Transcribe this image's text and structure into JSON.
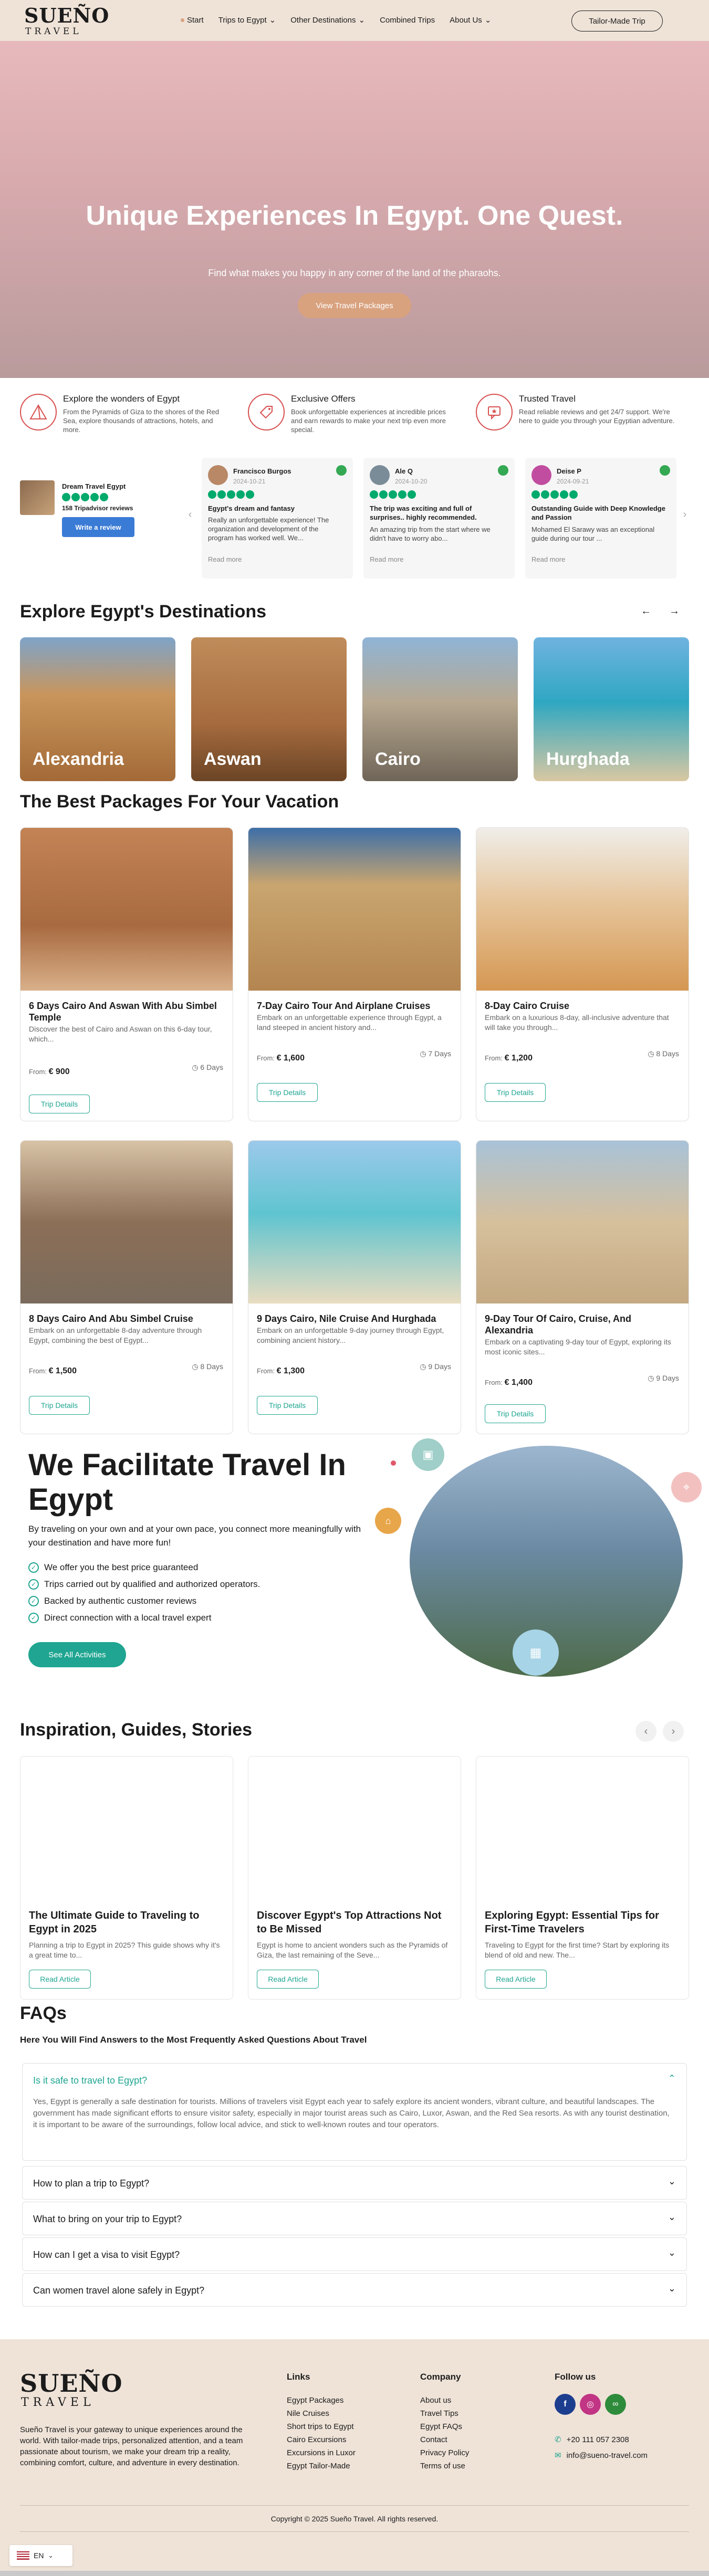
{
  "nav": {
    "logo_main": "SUEÑO",
    "logo_sub": "TRAVEL",
    "items": [
      {
        "label": "Start",
        "active": true
      },
      {
        "label": "Trips to Egypt",
        "dropdown": true
      },
      {
        "label": "Other Destinations",
        "dropdown": true
      },
      {
        "label": "Combined Trips",
        "dropdown": false
      },
      {
        "label": "About Us",
        "dropdown": true
      }
    ],
    "tailor_button": "Tailor-Made Trip"
  },
  "hero": {
    "title": "Unique Experiences In Egypt. One Quest.",
    "subtitle": "Find what makes you happy in any corner of the land of the pharaohs.",
    "button": "View Travel Packages"
  },
  "features": [
    {
      "icon": "pyramid-icon",
      "title": "Explore the wonders of Egypt",
      "text": "From the Pyramids of Giza to the shores of the Red Sea, explore thousands of attractions, hotels, and more."
    },
    {
      "icon": "tag-icon",
      "title": "Exclusive Offers",
      "text": "Book unforgettable experiences at incredible prices and earn rewards to make your next trip even more special."
    },
    {
      "icon": "review-icon",
      "title": "Trusted Travel",
      "text": "Read reliable reviews and get 24/7 support. We're here to guide you through your Egyptian adventure."
    }
  ],
  "tripadvisor": {
    "name": "Dream Travel Egypt",
    "reviews": "158 Tripadvisor reviews",
    "button": "Write a review"
  },
  "testimonials": [
    {
      "name": "Francisco Burgos",
      "date": "2024-10-21",
      "title": "Egypt's dream and fantasy",
      "text": "Really an unforgettable experience! The organization and development of the program has worked well. We...",
      "more": "Read more"
    },
    {
      "name": "Ale Q",
      "date": "2024-10-20",
      "title": "The trip was exciting and full of surprises.. highly recommended.",
      "text": "An amazing trip from the start where we didn't have to worry abo...",
      "more": "Read more"
    },
    {
      "name": "Deise P",
      "date": "2024-09-21",
      "title": "Outstanding Guide with Deep Knowledge and Passion",
      "text": "Mohamed El Sarawy was an exceptional guide during our tour ...",
      "more": "Read more"
    }
  ],
  "destinations": {
    "title": "Explore Egypt's Destinations",
    "items": [
      "Alexandria",
      "Aswan",
      "Cairo",
      "Hurghada"
    ]
  },
  "packages": {
    "title": "The Best Packages For Your Vacation",
    "items": [
      {
        "title": "6 Days Cairo And Aswan With Abu Simbel Temple",
        "desc": "Discover the best of Cairo and Aswan on this 6-day tour, which...",
        "price": "€ 900",
        "duration": "6 Days",
        "button": "Trip Details"
      },
      {
        "title": "7-Day Cairo Tour And Airplane Cruises",
        "desc": "Embark on an unforgettable experience through Egypt, a land steeped in ancient history and...",
        "price": "€ 1,600",
        "duration": "7 Days",
        "button": "Trip Details"
      },
      {
        "title": "8-Day Cairo Cruise",
        "desc": "Embark on a luxurious 8-day, all-inclusive adventure that will take you through...",
        "price": "€ 1,200",
        "duration": "8 Days",
        "button": "Trip Details"
      },
      {
        "title": "8 Days Cairo And Abu Simbel Cruise",
        "desc": "Embark on an unforgettable 8-day adventure through Egypt, combining the best of Egypt...",
        "price": "€ 1,500",
        "duration": "8 Days",
        "button": "Trip Details"
      },
      {
        "title": "9 Days Cairo, Nile Cruise And Hurghada",
        "desc": "Embark on an unforgettable 9-day journey through Egypt, combining ancient history...",
        "price": "€ 1,300",
        "duration": "9 Days",
        "button": "Trip Details"
      },
      {
        "title": "9-Day Tour Of Cairo, Cruise, And Alexandria",
        "desc": "Embark on a captivating 9-day tour of Egypt, exploring its most iconic sites...",
        "price": "€ 1,400",
        "duration": "9 Days",
        "button": "Trip Details"
      }
    ],
    "from_label": "From"
  },
  "facilitate": {
    "title": "We Facilitate Travel In Egypt",
    "text": "By traveling on your own and at your own pace, you connect more meaningfully with your destination and have more fun!",
    "points": [
      "We offer you the best price guaranteed",
      "Trips carried out by qualified and authorized operators.",
      "Backed by authentic customer reviews",
      "Direct connection with a local travel expert"
    ],
    "button": "See All Activities"
  },
  "blog": {
    "title": "Inspiration, Guides, Stories",
    "items": [
      {
        "title": "The Ultimate Guide to Traveling to Egypt in 2025",
        "text": "Planning a trip to Egypt in 2025? This guide shows why it's a great time to...",
        "button": "Read Article"
      },
      {
        "title": "Discover Egypt's Top Attractions Not to Be Missed",
        "text": "Egypt is home to ancient wonders such as the Pyramids of Giza, the last remaining of the Seve...",
        "button": "Read Article"
      },
      {
        "title": "Exploring Egypt: Essential Tips for First-Time Travelers",
        "text": "Traveling to Egypt for the first time? Start by exploring its blend of old and new. The...",
        "button": "Read Article"
      }
    ]
  },
  "faq": {
    "title": "FAQs",
    "subtitle": "Here You Will Find Answers to the Most Frequently Asked Questions About Travel",
    "items": [
      {
        "q": "Is it safe to travel to Egypt?",
        "a": "Yes, Egypt is generally a safe destination for tourists. Millions of travelers visit Egypt each year to safely explore its ancient wonders, vibrant culture, and beautiful landscapes. The government has made significant efforts to ensure visitor safety, especially in major tourist areas such as Cairo, Luxor, Aswan, and the Red Sea resorts. As with any tourist destination, it is important to be aware of the surroundings, follow local advice, and stick to well-known routes and tour operators."
      },
      {
        "q": "How to plan a trip to Egypt?"
      },
      {
        "q": "What to bring on your trip to Egypt?"
      },
      {
        "q": "How can I get a visa to visit Egypt?"
      },
      {
        "q": "Can women travel alone safely in Egypt?"
      }
    ]
  },
  "footer": {
    "about": "Sueño Travel is your gateway to unique experiences around the world. With tailor-made trips, personalized attention, and a team passionate about tourism, we make your dream trip a reality, combining comfort, culture, and adventure in every destination.",
    "links_title": "Links",
    "links": [
      "Egypt Packages",
      "Nile Cruises",
      "Short trips to Egypt",
      "Cairo Excursions",
      "Excursions in Luxor",
      "Egypt Tailor-Made"
    ],
    "company_title": "Company",
    "company": [
      "About us",
      "Travel Tips",
      "Egypt FAQs",
      "Contact",
      "Privacy Policy",
      "Terms of use"
    ],
    "follow_title": "Follow us",
    "phone": "+20 111 057 2308",
    "email": "info@sueno-travel.com",
    "copyright": "Copyright © 2025 Sueño Travel. All rights reserved."
  },
  "lang": "EN",
  "colors": {
    "accent": "#d9a27f",
    "teal": "#1fa591",
    "footer_bg": "#efe3d8"
  }
}
